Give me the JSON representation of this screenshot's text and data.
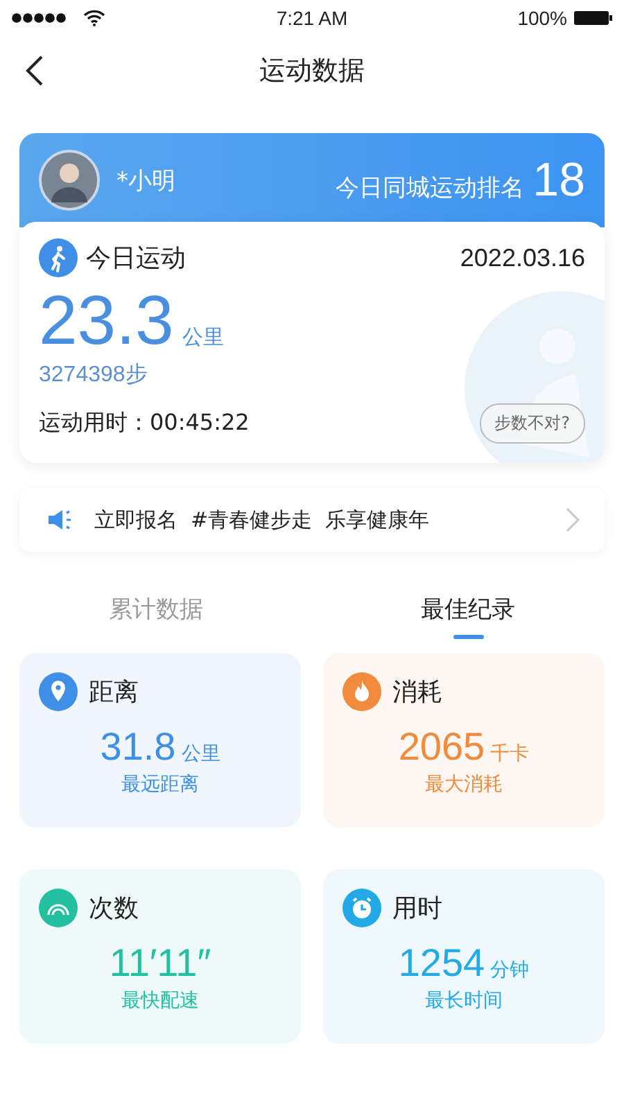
{
  "status_bar": {
    "time": "7:21 AM",
    "battery": "100%"
  },
  "nav": {
    "title": "运动数据"
  },
  "header": {
    "name": "*小明",
    "rank_label": "今日同城运动排名",
    "rank": "18"
  },
  "today": {
    "title": "今日运动",
    "date": "2022.03.16",
    "distance": "23.3",
    "distance_unit": "公里",
    "steps": "3274398步",
    "duration": "运动用时：00:45:22",
    "steps_button": "步数不对?"
  },
  "notice": {
    "text": "立即报名  #青春健步走  乐享健康年"
  },
  "tabs": [
    {
      "label": "累计数据",
      "selected": false
    },
    {
      "label": "最佳纪录",
      "selected": true
    }
  ],
  "cards": [
    {
      "kind": "distance",
      "title": "距离",
      "value": "31.8",
      "unit": "公里",
      "caption": "最远距离",
      "color": "#3f8fe6"
    },
    {
      "kind": "calories",
      "title": "消耗",
      "value": "2065",
      "unit": "千卡",
      "caption": "最大消耗",
      "color": "#f08a3c"
    },
    {
      "kind": "count",
      "title": "次数",
      "value": "11′11″",
      "caption": "最快配速",
      "color": "#22c0a0"
    },
    {
      "kind": "time",
      "title": "用时",
      "value": "1254",
      "unit": "分钟",
      "caption": "最长时间",
      "color": "#23a9e6"
    }
  ]
}
